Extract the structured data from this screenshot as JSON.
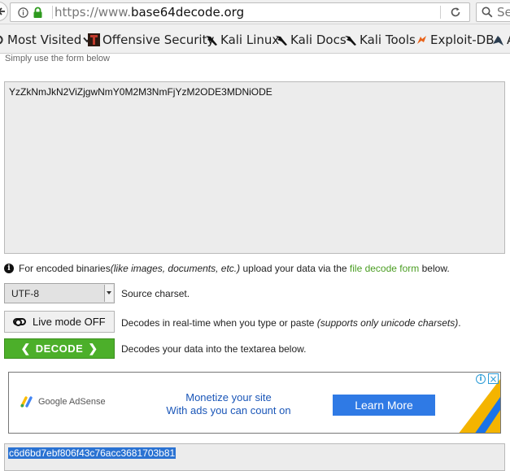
{
  "browser": {
    "url_prefix": "https://www.",
    "url_host": "base64decode.org",
    "search_placeholder": "Sea"
  },
  "bookmarks": [
    {
      "label": "Most Visited",
      "icon": "gear-icon"
    },
    {
      "label": "Offensive Security",
      "icon": "offsec-icon"
    },
    {
      "label": "Kali Linux",
      "icon": "kali-dragon-icon"
    },
    {
      "label": "Kali Docs",
      "icon": "kali-dragon-icon"
    },
    {
      "label": "Kali Tools",
      "icon": "kali-dragon-icon"
    },
    {
      "label": "Exploit-DB",
      "icon": "exploit-db-icon"
    },
    {
      "label": "A",
      "icon": "aircrack-icon"
    }
  ],
  "page": {
    "intro": "Simply use the form below",
    "input_value": "YzZkNmJkN2ViZjgwNmY0M2M3NmFjYzM2ODE3MDNiODE",
    "note": {
      "prefix": "For encoded binaries ",
      "italic": "(like images, documents, etc.)",
      "middle": " upload your data via the ",
      "link": "file decode form",
      "suffix": " below."
    },
    "charset": {
      "value": "UTF-8",
      "label": "Source charset."
    },
    "live_mode": {
      "label": "Live mode OFF",
      "desc_prefix": "Decodes in real-time when you type or paste ",
      "desc_italic": "(supports only unicode charsets)",
      "desc_suffix": "."
    },
    "decode": {
      "label": "DECODE",
      "desc": "Decodes your data into the textarea below."
    },
    "output_value": "c6d6bd7ebf806f43c76acc3681703b81"
  },
  "ad": {
    "brand": "Google AdSense",
    "line1": "Monetize your site",
    "line2": "With ads you can count on",
    "cta": "Learn More"
  },
  "colors": {
    "decode_green": "#4caf2a",
    "link_green": "#4a9d22",
    "ad_blue": "#2f7ae5",
    "selection_blue": "#2a72d2"
  }
}
